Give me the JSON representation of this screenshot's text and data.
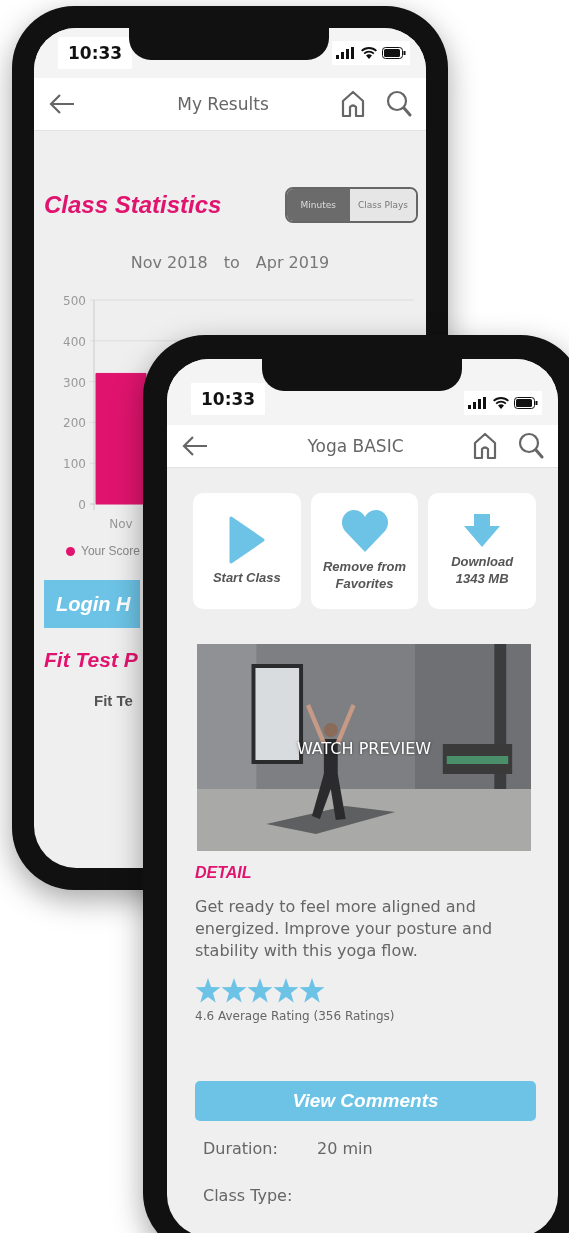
{
  "back_phone": {
    "status_bar": {
      "time": "10:33"
    },
    "nav": {
      "title": "My Results"
    },
    "section_title": "Class Statistics",
    "toggle": [
      {
        "label": "Minutes",
        "selected": true
      },
      {
        "label": "Class Plays",
        "selected": false
      }
    ],
    "date_range": {
      "from": "Nov 2018",
      "to_word": "to",
      "to": "Apr 2019"
    },
    "chart": {
      "chart_data": {
        "type": "bar",
        "categories": [
          "Nov"
        ],
        "yticks": [
          0,
          100,
          200,
          300,
          400,
          500
        ],
        "ylim": [
          0,
          500
        ],
        "grid": true,
        "series": [
          {
            "name": "Your Score",
            "color": "#e0146e",
            "values": [
              320
            ]
          }
        ]
      }
    },
    "login_button": "Login H",
    "fit_test_title": "Fit Test P",
    "fit_test_label": "Fit Te"
  },
  "front_phone": {
    "status_bar": {
      "time": "10:33"
    },
    "nav": {
      "title": "Yoga BASIC"
    },
    "actions": [
      {
        "kind": "play",
        "label": "Start Class"
      },
      {
        "kind": "heart",
        "label": "Remove from Favorites"
      },
      {
        "kind": "download",
        "label": "Download 1343 MB"
      }
    ],
    "preview": {
      "kind": "picture",
      "label": "WATCH PREVIEW"
    },
    "detail_heading": "DETAIL",
    "description": "Get ready to feel more aligned and energized.  Improve your posture and stability with this yoga flow.",
    "rating": {
      "stars": 5,
      "text": "4.6 Average Rating (356 Ratings)"
    },
    "comments_button": "View Comments",
    "info": [
      {
        "label": "Duration:",
        "value": "20 min"
      },
      {
        "label": "Class Type:"
      }
    ]
  }
}
